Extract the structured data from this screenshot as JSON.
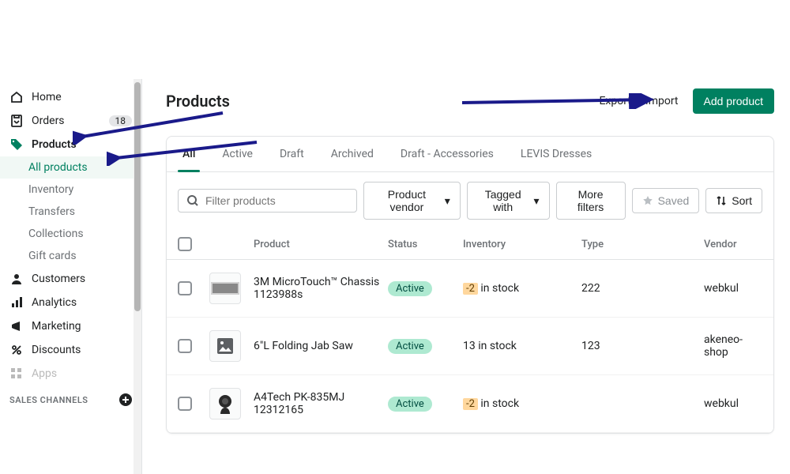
{
  "sidebar": {
    "items": [
      {
        "label": "Home",
        "icon": "home"
      },
      {
        "label": "Orders",
        "icon": "orders",
        "badge": "18"
      },
      {
        "label": "Products",
        "icon": "tag",
        "selected": true
      },
      {
        "label": "All products",
        "sub": true,
        "active": true
      },
      {
        "label": "Inventory",
        "sub": true
      },
      {
        "label": "Transfers",
        "sub": true
      },
      {
        "label": "Collections",
        "sub": true
      },
      {
        "label": "Gift cards",
        "sub": true
      },
      {
        "label": "Customers",
        "icon": "person"
      },
      {
        "label": "Analytics",
        "icon": "bars"
      },
      {
        "label": "Marketing",
        "icon": "megaphone"
      },
      {
        "label": "Discounts",
        "icon": "discount"
      },
      {
        "label": "Apps",
        "icon": "apps",
        "disabled": true
      }
    ],
    "section": "SALES CHANNELS"
  },
  "page": {
    "title": "Products",
    "export_label": "Export",
    "import_label": "Import",
    "add_label": "Add product"
  },
  "tabs": [
    "All",
    "Active",
    "Draft",
    "Archived",
    "Draft - Accessories",
    "LEVIS Dresses"
  ],
  "filters": {
    "search_placeholder": "Filter products",
    "vendor": "Product vendor",
    "tagged": "Tagged with",
    "more": "More filters",
    "saved": "Saved",
    "sort": "Sort"
  },
  "columns": {
    "product": "Product",
    "status": "Status",
    "inventory": "Inventory",
    "type": "Type",
    "vendor": "Vendor"
  },
  "rows": [
    {
      "name": "3M MicroTouch™ Chassis 1123988s",
      "status": "Active",
      "inv_count": "-2",
      "inv_suffix": " in stock",
      "inv_neg": true,
      "type": "222",
      "vendor": "webkul",
      "thumb": "monitor"
    },
    {
      "name": "6\"L Folding Jab Saw",
      "status": "Active",
      "inv_count": "13 in stock",
      "inv_neg": false,
      "type": "123",
      "vendor": "akeneo-shop",
      "thumb": "placeholder"
    },
    {
      "name": "A4Tech PK-835MJ 12312165",
      "status": "Active",
      "inv_count": "-2",
      "inv_suffix": " in stock",
      "inv_neg": true,
      "type": "",
      "vendor": "webkul",
      "thumb": "webcam"
    }
  ]
}
